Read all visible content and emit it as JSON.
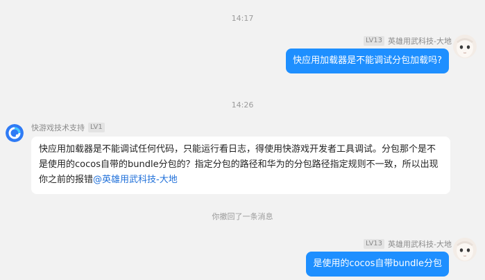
{
  "chat": {
    "timestamps": [
      "14:17",
      "14:26"
    ],
    "system_note": "你撤回了一条消息",
    "user": {
      "name": "英雄用武科技-大地",
      "level": "LV13"
    },
    "support": {
      "name": "快游戏技术支持",
      "level": "LV1"
    },
    "messages": [
      {
        "from": "user",
        "text": "快应用加载器是不能调试分包加载吗?"
      },
      {
        "from": "support",
        "text": "快应用加载器是不能调试任何代码，只能运行看日志，得使用快游戏开发者工具调试。分包那个是不是使用的cocos自带的bundle分包的？指定分包的路径和华为的分包路径指定规则不一致，所以出现你之前的报错",
        "mention": "@英雄用武科技-大地"
      },
      {
        "from": "user",
        "text": "是使用的cocos自带bundle分包"
      }
    ]
  },
  "colors": {
    "background": "#f2f2f2",
    "outgoing_bubble": "#1e8fff",
    "incoming_bubble": "#ffffff",
    "mention": "#1e6fd9",
    "meta_text": "#8a8a8a"
  },
  "icons": {
    "user_avatar": "user-avatar-photo",
    "support_avatar": "quickgame-logo-icon"
  }
}
